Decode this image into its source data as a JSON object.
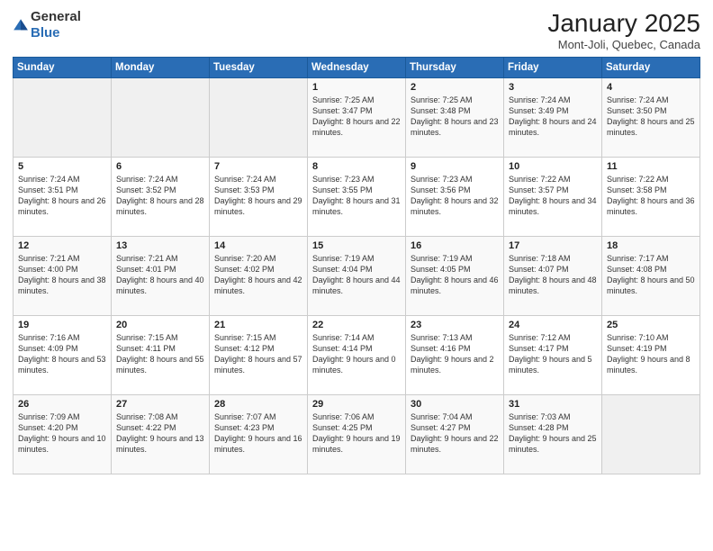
{
  "header": {
    "logo_general": "General",
    "logo_blue": "Blue",
    "month_year": "January 2025",
    "location": "Mont-Joli, Quebec, Canada"
  },
  "days_of_week": [
    "Sunday",
    "Monday",
    "Tuesday",
    "Wednesday",
    "Thursday",
    "Friday",
    "Saturday"
  ],
  "weeks": [
    [
      {
        "day": "",
        "sunrise": "",
        "sunset": "",
        "daylight": ""
      },
      {
        "day": "",
        "sunrise": "",
        "sunset": "",
        "daylight": ""
      },
      {
        "day": "",
        "sunrise": "",
        "sunset": "",
        "daylight": ""
      },
      {
        "day": "1",
        "sunrise": "Sunrise: 7:25 AM",
        "sunset": "Sunset: 3:47 PM",
        "daylight": "Daylight: 8 hours and 22 minutes."
      },
      {
        "day": "2",
        "sunrise": "Sunrise: 7:25 AM",
        "sunset": "Sunset: 3:48 PM",
        "daylight": "Daylight: 8 hours and 23 minutes."
      },
      {
        "day": "3",
        "sunrise": "Sunrise: 7:24 AM",
        "sunset": "Sunset: 3:49 PM",
        "daylight": "Daylight: 8 hours and 24 minutes."
      },
      {
        "day": "4",
        "sunrise": "Sunrise: 7:24 AM",
        "sunset": "Sunset: 3:50 PM",
        "daylight": "Daylight: 8 hours and 25 minutes."
      }
    ],
    [
      {
        "day": "5",
        "sunrise": "Sunrise: 7:24 AM",
        "sunset": "Sunset: 3:51 PM",
        "daylight": "Daylight: 8 hours and 26 minutes."
      },
      {
        "day": "6",
        "sunrise": "Sunrise: 7:24 AM",
        "sunset": "Sunset: 3:52 PM",
        "daylight": "Daylight: 8 hours and 28 minutes."
      },
      {
        "day": "7",
        "sunrise": "Sunrise: 7:24 AM",
        "sunset": "Sunset: 3:53 PM",
        "daylight": "Daylight: 8 hours and 29 minutes."
      },
      {
        "day": "8",
        "sunrise": "Sunrise: 7:23 AM",
        "sunset": "Sunset: 3:55 PM",
        "daylight": "Daylight: 8 hours and 31 minutes."
      },
      {
        "day": "9",
        "sunrise": "Sunrise: 7:23 AM",
        "sunset": "Sunset: 3:56 PM",
        "daylight": "Daylight: 8 hours and 32 minutes."
      },
      {
        "day": "10",
        "sunrise": "Sunrise: 7:22 AM",
        "sunset": "Sunset: 3:57 PM",
        "daylight": "Daylight: 8 hours and 34 minutes."
      },
      {
        "day": "11",
        "sunrise": "Sunrise: 7:22 AM",
        "sunset": "Sunset: 3:58 PM",
        "daylight": "Daylight: 8 hours and 36 minutes."
      }
    ],
    [
      {
        "day": "12",
        "sunrise": "Sunrise: 7:21 AM",
        "sunset": "Sunset: 4:00 PM",
        "daylight": "Daylight: 8 hours and 38 minutes."
      },
      {
        "day": "13",
        "sunrise": "Sunrise: 7:21 AM",
        "sunset": "Sunset: 4:01 PM",
        "daylight": "Daylight: 8 hours and 40 minutes."
      },
      {
        "day": "14",
        "sunrise": "Sunrise: 7:20 AM",
        "sunset": "Sunset: 4:02 PM",
        "daylight": "Daylight: 8 hours and 42 minutes."
      },
      {
        "day": "15",
        "sunrise": "Sunrise: 7:19 AM",
        "sunset": "Sunset: 4:04 PM",
        "daylight": "Daylight: 8 hours and 44 minutes."
      },
      {
        "day": "16",
        "sunrise": "Sunrise: 7:19 AM",
        "sunset": "Sunset: 4:05 PM",
        "daylight": "Daylight: 8 hours and 46 minutes."
      },
      {
        "day": "17",
        "sunrise": "Sunrise: 7:18 AM",
        "sunset": "Sunset: 4:07 PM",
        "daylight": "Daylight: 8 hours and 48 minutes."
      },
      {
        "day": "18",
        "sunrise": "Sunrise: 7:17 AM",
        "sunset": "Sunset: 4:08 PM",
        "daylight": "Daylight: 8 hours and 50 minutes."
      }
    ],
    [
      {
        "day": "19",
        "sunrise": "Sunrise: 7:16 AM",
        "sunset": "Sunset: 4:09 PM",
        "daylight": "Daylight: 8 hours and 53 minutes."
      },
      {
        "day": "20",
        "sunrise": "Sunrise: 7:15 AM",
        "sunset": "Sunset: 4:11 PM",
        "daylight": "Daylight: 8 hours and 55 minutes."
      },
      {
        "day": "21",
        "sunrise": "Sunrise: 7:15 AM",
        "sunset": "Sunset: 4:12 PM",
        "daylight": "Daylight: 8 hours and 57 minutes."
      },
      {
        "day": "22",
        "sunrise": "Sunrise: 7:14 AM",
        "sunset": "Sunset: 4:14 PM",
        "daylight": "Daylight: 9 hours and 0 minutes."
      },
      {
        "day": "23",
        "sunrise": "Sunrise: 7:13 AM",
        "sunset": "Sunset: 4:16 PM",
        "daylight": "Daylight: 9 hours and 2 minutes."
      },
      {
        "day": "24",
        "sunrise": "Sunrise: 7:12 AM",
        "sunset": "Sunset: 4:17 PM",
        "daylight": "Daylight: 9 hours and 5 minutes."
      },
      {
        "day": "25",
        "sunrise": "Sunrise: 7:10 AM",
        "sunset": "Sunset: 4:19 PM",
        "daylight": "Daylight: 9 hours and 8 minutes."
      }
    ],
    [
      {
        "day": "26",
        "sunrise": "Sunrise: 7:09 AM",
        "sunset": "Sunset: 4:20 PM",
        "daylight": "Daylight: 9 hours and 10 minutes."
      },
      {
        "day": "27",
        "sunrise": "Sunrise: 7:08 AM",
        "sunset": "Sunset: 4:22 PM",
        "daylight": "Daylight: 9 hours and 13 minutes."
      },
      {
        "day": "28",
        "sunrise": "Sunrise: 7:07 AM",
        "sunset": "Sunset: 4:23 PM",
        "daylight": "Daylight: 9 hours and 16 minutes."
      },
      {
        "day": "29",
        "sunrise": "Sunrise: 7:06 AM",
        "sunset": "Sunset: 4:25 PM",
        "daylight": "Daylight: 9 hours and 19 minutes."
      },
      {
        "day": "30",
        "sunrise": "Sunrise: 7:04 AM",
        "sunset": "Sunset: 4:27 PM",
        "daylight": "Daylight: 9 hours and 22 minutes."
      },
      {
        "day": "31",
        "sunrise": "Sunrise: 7:03 AM",
        "sunset": "Sunset: 4:28 PM",
        "daylight": "Daylight: 9 hours and 25 minutes."
      },
      {
        "day": "",
        "sunrise": "",
        "sunset": "",
        "daylight": ""
      }
    ]
  ]
}
